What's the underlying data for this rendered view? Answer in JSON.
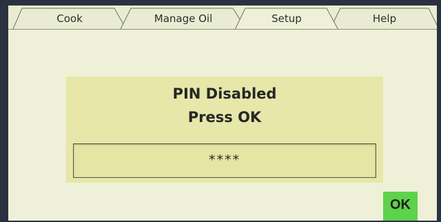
{
  "tabs": [
    {
      "label": "Cook",
      "selected": false
    },
    {
      "label": "Manage Oil",
      "selected": false
    },
    {
      "label": "Setup",
      "selected": true
    },
    {
      "label": "Help",
      "selected": false
    }
  ],
  "dialog": {
    "title": "PIN Disabled",
    "instruction": "Press OK",
    "pin_value": "****"
  },
  "ok_button": {
    "label": "OK"
  },
  "colors": {
    "screen_background": "#eef1d8",
    "panel": "#e6e7a9",
    "ok_button": "#5ed24a",
    "bezel": "#2a3241"
  }
}
